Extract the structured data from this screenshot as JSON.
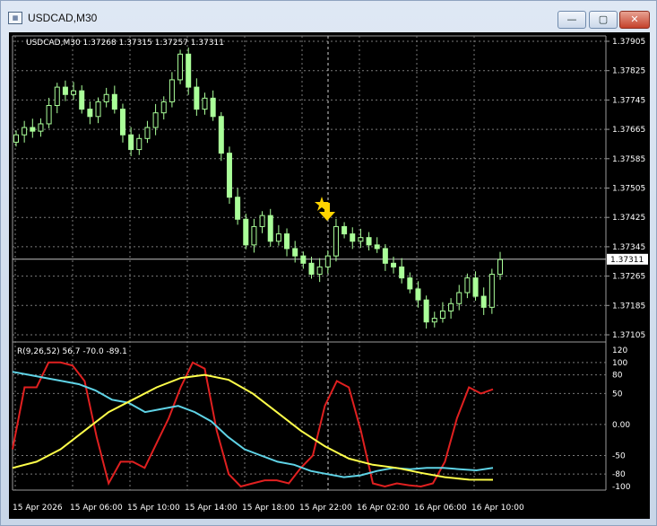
{
  "window": {
    "title": "USDCAD,M30",
    "icon": "chart-window-icon",
    "buttons": {
      "minimize": "—",
      "maximize": "▢",
      "close": "✕"
    }
  },
  "chart": {
    "symbol_info": "USDCAD,M30  1.37268 1.37315 1.37257 1.37311",
    "price_labels": [
      "1.37905",
      "1.37825",
      "1.37745",
      "1.37665",
      "1.37585",
      "1.37505",
      "1.37425",
      "1.37345",
      "1.37265",
      "1.37185",
      "1.37105"
    ],
    "current_price": "1.37311",
    "indicator_label": "R(9,26,52) 56.7 -70.0 -89.1",
    "indicator_labels": [
      "120",
      "100",
      "80",
      "50",
      "0.00",
      "-50",
      "-80",
      "-100"
    ],
    "time_labels": [
      "15 Apr 2026",
      "15 Apr 06:00",
      "15 Apr 10:00",
      "15 Apr 14:00",
      "15 Apr 18:00",
      "15 Apr 22:00",
      "16 Apr 02:00",
      "16 Apr 06:00",
      "16 Apr 10:00"
    ],
    "colors": {
      "background": "#000000",
      "grid": "#7a7a7a",
      "candle": "#aaff99",
      "red_line": "#e02020",
      "cyan_line": "#5fd3e6",
      "yellow_line": "#ffff4a",
      "arrow": "#ffd400",
      "current_price_label_bg": "#ffffff"
    }
  },
  "chart_data": [
    {
      "type": "candlestick",
      "title": "USDCAD,M30",
      "ylim": [
        1.371,
        1.3795
      ],
      "current_price": 1.37311,
      "ohlc_close_sequence": [
        1.3765,
        1.3767,
        1.3766,
        1.3768,
        1.3773,
        1.3778,
        1.3776,
        1.3777,
        1.3772,
        1.377,
        1.3774,
        1.3776,
        1.3772,
        1.3765,
        1.3761,
        1.3764,
        1.3767,
        1.3771,
        1.3774,
        1.378,
        1.3787,
        1.3778,
        1.3772,
        1.3775,
        1.377,
        1.376,
        1.3748,
        1.3742,
        1.3735,
        1.374,
        1.3743,
        1.3736,
        1.3738,
        1.3734,
        1.3732,
        1.373,
        1.3727,
        1.3729,
        1.3732,
        1.374,
        1.3738,
        1.3736,
        1.3737,
        1.3735,
        1.3734,
        1.373,
        1.3729,
        1.3726,
        1.3723,
        1.372,
        1.3714,
        1.3715,
        1.3717,
        1.3719,
        1.3722,
        1.3726,
        1.3721,
        1.3718,
        1.3727,
        1.3731
      ]
    },
    {
      "type": "line",
      "title": "R(9,26,52)",
      "ylim": [
        -100,
        120
      ],
      "series": [
        {
          "name": "R(9)",
          "color": "#e02020",
          "values": [
            -40,
            60,
            60,
            100,
            100,
            95,
            70,
            -20,
            -95,
            -60,
            -60,
            -70,
            -30,
            10,
            60,
            100,
            90,
            -10,
            -80,
            -100,
            -95,
            -90,
            -90,
            -95,
            -70,
            -50,
            30,
            70,
            60,
            -10,
            -95,
            -100,
            -95,
            -98,
            -100,
            -95,
            -60,
            10,
            60,
            50,
            56.7
          ]
        },
        {
          "name": "R(26)",
          "color": "#5fd3e6",
          "values": [
            85,
            80,
            75,
            70,
            65,
            55,
            40,
            35,
            20,
            25,
            30,
            20,
            5,
            -20,
            -40,
            -50,
            -60,
            -65,
            -75,
            -80,
            -85,
            -82,
            -75,
            -70,
            -72,
            -70,
            -70,
            -72,
            -74,
            -70
          ]
        },
        {
          "name": "R(52)",
          "color": "#ffff4a",
          "values": [
            -70,
            -60,
            -40,
            -10,
            20,
            40,
            60,
            75,
            80,
            72,
            50,
            20,
            -10,
            -35,
            -55,
            -65,
            -70,
            -78,
            -85,
            -89,
            -89.1
          ]
        }
      ]
    }
  ]
}
